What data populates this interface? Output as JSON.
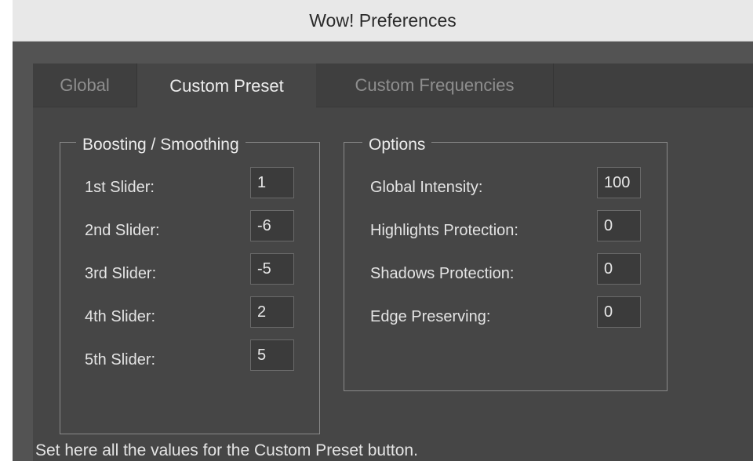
{
  "window": {
    "title": "Wow! Preferences"
  },
  "tabs": [
    {
      "label": "Global",
      "active": false
    },
    {
      "label": "Custom Preset",
      "active": true
    },
    {
      "label": "Custom Frequencies",
      "active": false
    }
  ],
  "boosting": {
    "title": "Boosting / Smoothing",
    "rows": [
      {
        "label": "1st Slider:",
        "value": "1"
      },
      {
        "label": "2nd Slider:",
        "value": "-6"
      },
      {
        "label": "3rd Slider:",
        "value": "-5"
      },
      {
        "label": "4th Slider:",
        "value": "2"
      },
      {
        "label": "5th Slider:",
        "value": "5"
      }
    ]
  },
  "options": {
    "title": "Options",
    "rows": [
      {
        "label": "Global Intensity:",
        "value": "100"
      },
      {
        "label": "Highlights Protection:",
        "value": "0"
      },
      {
        "label": "Shadows Protection:",
        "value": "0"
      },
      {
        "label": "Edge Preserving:",
        "value": "0"
      }
    ]
  },
  "footer": {
    "text": "Set here all the values for the Custom Preset button."
  },
  "colors": {
    "title_bar": "#e8e8e8",
    "panel": "#464646",
    "tab_bar": "#3f3f3f",
    "text": "#e4e4e4",
    "inactive_tab_text": "#8e8e8e"
  }
}
